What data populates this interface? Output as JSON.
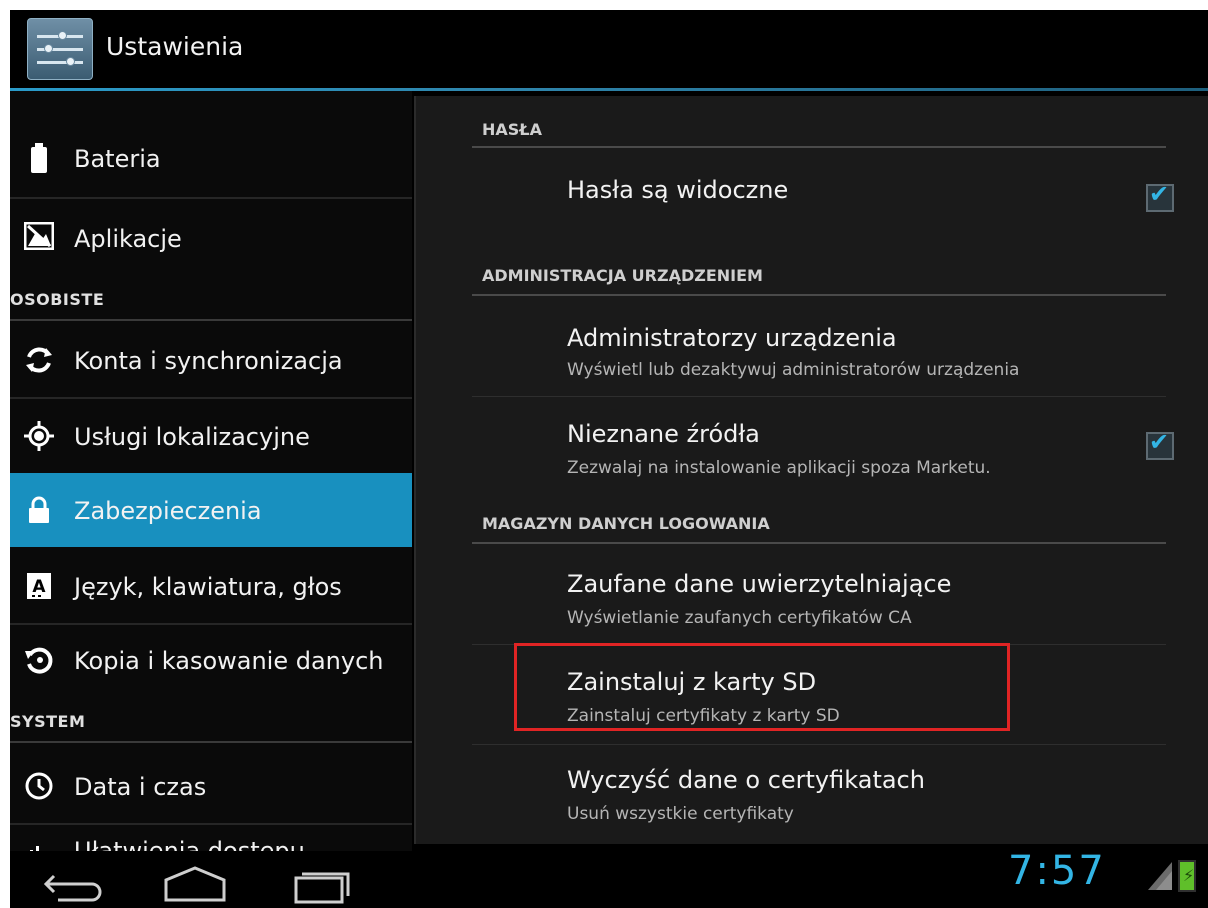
{
  "action_bar": {
    "title": "Ustawienia",
    "icon": "settings-sliders-icon"
  },
  "sidebar": {
    "items": [
      {
        "label": "Bateria",
        "icon": "battery-icon"
      },
      {
        "label": "Aplikacje",
        "icon": "applications-icon"
      },
      {
        "label": "Konta i synchronizacja",
        "icon": "sync-icon"
      },
      {
        "label": "Usługi lokalizacyjne",
        "icon": "location-icon"
      },
      {
        "label": "Zabezpieczenia",
        "icon": "lock-icon",
        "selected": true
      },
      {
        "label": "Język, klawiatura, głos",
        "icon": "language-icon"
      },
      {
        "label": "Kopia i kasowanie danych",
        "icon": "backup-icon"
      },
      {
        "label": "Data i czas",
        "icon": "clock-icon"
      },
      {
        "label": "Ułatwienia dostępu",
        "icon": "accessibility-icon"
      }
    ],
    "headers": {
      "personal": "OSOBISTE",
      "system": "SYSTEM"
    }
  },
  "security": {
    "passwords_header": "HASŁA",
    "passwords_visible": {
      "title": "Hasła są widoczne",
      "checked": true
    },
    "device_admin_header": "ADMINISTRACJA URZĄDZENIEM",
    "device_admins": {
      "title": "Administratorzy urządzenia",
      "summary": "Wyświetl lub dezaktywuj administratorów urządzenia"
    },
    "unknown_sources": {
      "title": "Nieznane źródła",
      "summary": "Zezwalaj na instalowanie aplikacji spoza Marketu.",
      "checked": true
    },
    "credential_storage_header": "MAGAZYN DANYCH LOGOWANIA",
    "trusted_credentials": {
      "title": "Zaufane dane uwierzytelniające",
      "summary": "Wyświetlanie zaufanych certyfikatów CA"
    },
    "install_from_sd": {
      "title": "Zainstaluj z karty SD",
      "summary": "Zainstaluj certyfikaty z karty SD"
    },
    "clear_credentials": {
      "title": "Wyczyść dane o certyfikatach",
      "summary": "Usuń wszystkie certyfikaty"
    }
  },
  "status_bar": {
    "time": "7:57"
  },
  "colors": {
    "accent": "#33b5e5",
    "selected": "#1890bf",
    "highlight": "#e02424"
  }
}
